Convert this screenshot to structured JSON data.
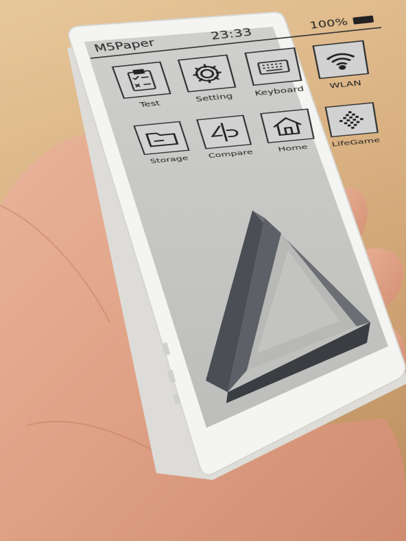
{
  "status_bar": {
    "device_name": "M5Paper",
    "clock": "23:33",
    "battery": "100%",
    "battery_icon": "battery-full-icon"
  },
  "apps": [
    {
      "label": "Test",
      "icon": "clipboard-checklist-icon"
    },
    {
      "label": "Setting",
      "icon": "gear-icon"
    },
    {
      "label": "Keyboard",
      "icon": "keyboard-icon"
    },
    {
      "label": "WLAN",
      "icon": "wifi-icon"
    },
    {
      "label": "Storage",
      "icon": "folder-icon"
    },
    {
      "label": "Compare",
      "icon": "compare-icon"
    },
    {
      "label": "Home",
      "icon": "home-icon"
    },
    {
      "label": "LifeGame",
      "icon": "life-game-icon"
    }
  ],
  "wallpaper": "penrose-triangle",
  "colors": {
    "device_body": "#f4f4f2",
    "screen": "#c8c8c6",
    "skin": "#e0a58a",
    "table": "#d9b182"
  }
}
